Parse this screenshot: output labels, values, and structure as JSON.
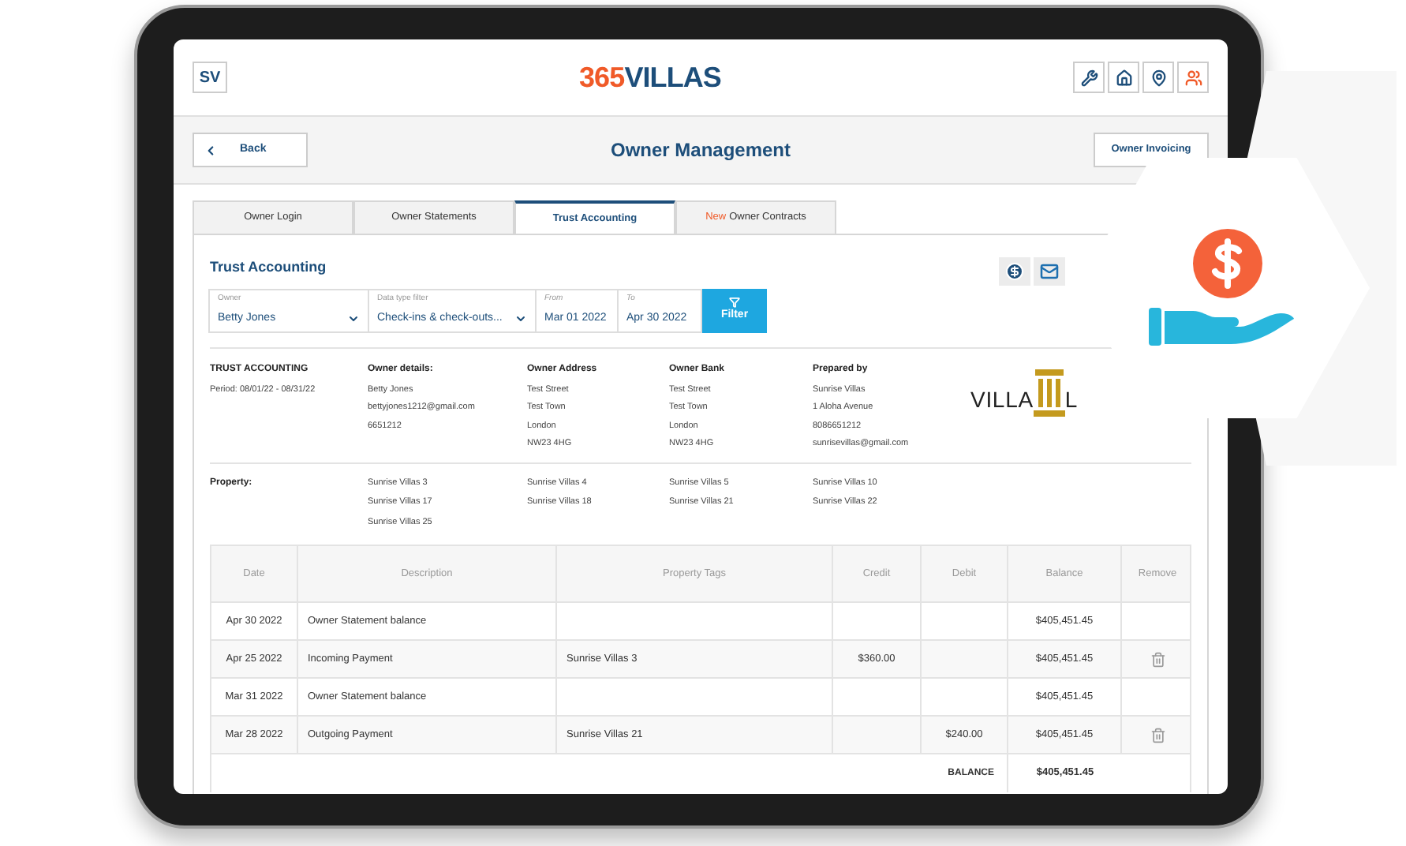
{
  "header": {
    "user_initials": "SV",
    "logo": {
      "accent": "365",
      "text": "VILLAS"
    }
  },
  "toolbar": {
    "back": "Back",
    "title": "Owner Management",
    "action": "Owner Invoicing"
  },
  "tabs": [
    {
      "label": "Owner Login",
      "selected": false
    },
    {
      "label": "Owner Statements",
      "selected": false
    },
    {
      "label": "Trust Accounting",
      "selected": true
    },
    {
      "label": "Owner Contracts",
      "badge": "New",
      "selected": false
    }
  ],
  "section_title": "Trust Accounting",
  "filters": [
    {
      "kind": "select",
      "label": "Owner",
      "value": "Betty Jones"
    },
    {
      "kind": "select",
      "label": "Data type filter",
      "value": "Check-ins & check-outs..."
    },
    {
      "kind": "date",
      "label": "From",
      "value": "Mar 01 2022"
    },
    {
      "kind": "date",
      "label": "To",
      "value": "Apr 30 2022"
    }
  ],
  "filter_button": "Filter",
  "info": [
    {
      "heading": "TRUST ACCOUNTING",
      "lines": [
        "Period: 08/01/22 - 08/31/22"
      ]
    },
    {
      "heading": "Owner details:",
      "lines": [
        "Betty Jones",
        "bettyjones1212@gmail.com",
        "6651212"
      ]
    },
    {
      "heading": "Owner Address",
      "lines": [
        "Test Street",
        "Test Town",
        "London",
        "NW23 4HG"
      ]
    },
    {
      "heading": "Owner Bank",
      "lines": [
        "Test Street",
        "Test Town",
        "London",
        "NW23 4HG"
      ]
    },
    {
      "heading": "Prepared by",
      "lines": [
        "Sunrise Villas",
        "1 Aloha Avenue",
        "8086651212",
        "sunrisevillas@gmail.com"
      ]
    }
  ],
  "company_logo": {
    "text": "VILLA",
    "tail": "L"
  },
  "property": {
    "label": "Property:",
    "items": [
      "Sunrise Villas 3",
      "Sunrise Villas 4",
      "Sunrise Villas 5",
      "Sunrise Villas 10",
      "Sunrise Villas 17",
      "Sunrise Villas 18",
      "Sunrise Villas 21",
      "Sunrise Villas 22",
      "Sunrise Villas 25"
    ]
  },
  "table": {
    "columns": [
      "Date",
      "Description",
      "Property Tags",
      "Credit",
      "Debit",
      "Balance",
      "Remove"
    ],
    "rows": [
      {
        "date": "Apr 30 2022",
        "description": "Owner Statement balance",
        "tags": "",
        "credit": "",
        "debit": "",
        "balance": "$405,451.45",
        "removable": false
      },
      {
        "date": "Apr 25 2022",
        "description": "Incoming Payment",
        "tags": "Sunrise Villas 3",
        "credit": "$360.00",
        "debit": "",
        "balance": "$405,451.45",
        "removable": true
      },
      {
        "date": "Mar 31 2022",
        "description": "Owner Statement balance",
        "tags": "",
        "credit": "",
        "debit": "",
        "balance": "$405,451.45",
        "removable": false
      },
      {
        "date": "Mar 28 2022",
        "description": "Outgoing Payment",
        "tags": "Sunrise Villas 21",
        "credit": "",
        "debit": "$240.00",
        "balance": "$405,451.45",
        "removable": true
      }
    ],
    "footer": {
      "label": "BALANCE",
      "value": "$405,451.45"
    }
  }
}
